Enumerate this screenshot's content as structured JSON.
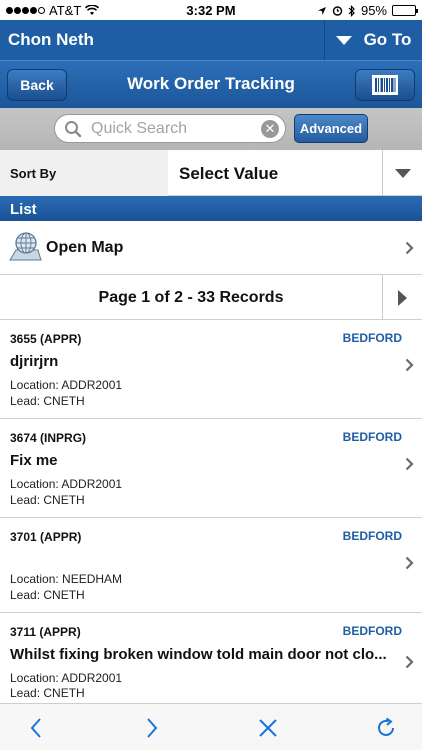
{
  "status_bar": {
    "carrier": "AT&T",
    "time": "3:32 PM",
    "battery": "95%"
  },
  "user_bar": {
    "username": "Chon Neth",
    "goto_label": "Go To"
  },
  "nav": {
    "back_label": "Back",
    "title": "Work Order Tracking"
  },
  "search": {
    "placeholder": "Quick Search",
    "advanced_label": "Advanced"
  },
  "sort": {
    "label": "Sort By",
    "value": "Select Value"
  },
  "list": {
    "header": "List",
    "open_map_label": "Open Map",
    "pager_text": "Page 1 of 2 - 33 Records"
  },
  "records": [
    {
      "id": "3655 (APPR)",
      "site": "BEDFORD",
      "description": "djrirjrn",
      "location": "Location: ADDR2001",
      "lead": "Lead: CNETH"
    },
    {
      "id": "3674 (INPRG)",
      "site": "BEDFORD",
      "description": "Fix me",
      "location": "Location: ADDR2001",
      "lead": "Lead: CNETH"
    },
    {
      "id": "3701 (APPR)",
      "site": "BEDFORD",
      "description": "",
      "location": "Location: NEEDHAM",
      "lead": "Lead: CNETH"
    },
    {
      "id": "3711 (APPR)",
      "site": "BEDFORD",
      "description": "Whilst fixing broken window told main door not clo...",
      "location": "Location: ADDR2001",
      "lead": "Lead: CNETH"
    }
  ],
  "colors": {
    "brand_blue": "#1e5ea5",
    "site_text": "#1e5ea5",
    "toolbar_icon": "#1a73d9"
  },
  "icons": {
    "back": "chevron-left-icon",
    "forward": "chevron-right-icon",
    "stop": "close-icon",
    "reload": "refresh-icon"
  }
}
